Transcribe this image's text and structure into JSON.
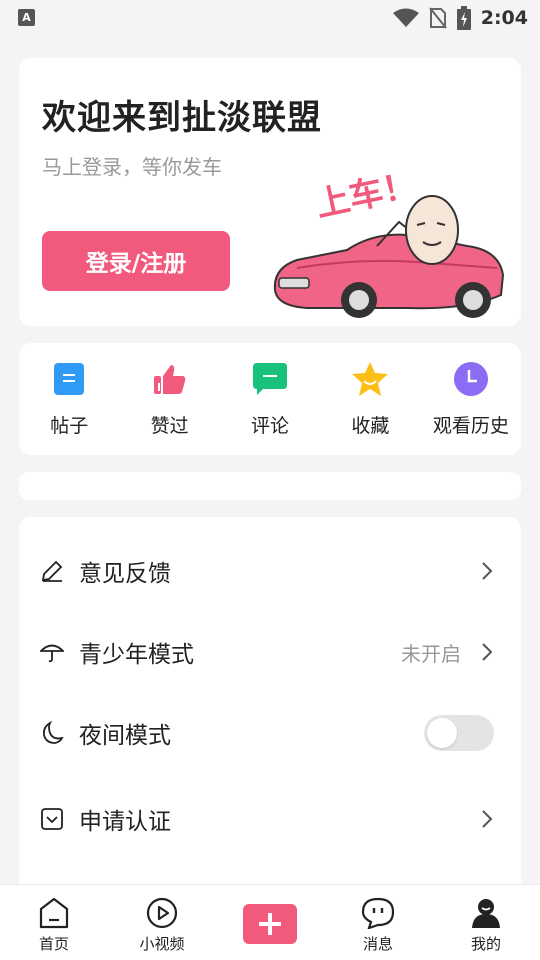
{
  "status_bar": {
    "left_badge": "A",
    "time": "2:04",
    "icons": [
      "wifi-icon",
      "no-sim-icon",
      "battery-charging-icon"
    ]
  },
  "hero": {
    "title": "欢迎来到扯淡联盟",
    "subtitle": "马上登录，等你发车",
    "login_button": "登录/注册",
    "art_text": "上车！"
  },
  "quick_actions": [
    {
      "label": "帖子",
      "icon": "post-icon",
      "color": "#2f9bf5"
    },
    {
      "label": "赞过",
      "icon": "thumb-up-icon",
      "color": "#f25a7d"
    },
    {
      "label": "评论",
      "icon": "comment-icon",
      "color": "#19c27a"
    },
    {
      "label": "收藏",
      "icon": "star-icon",
      "color": "#fbbf18"
    },
    {
      "label": "观看历史",
      "icon": "clock-icon",
      "color": "#8b6cf5"
    }
  ],
  "settings": [
    {
      "label": "意见反馈",
      "icon": "pencil-icon",
      "value": ""
    },
    {
      "label": "青少年模式",
      "icon": "umbrella-icon",
      "value": "未开启"
    },
    {
      "label": "夜间模式",
      "icon": "moon-icon",
      "toggle_on": false
    },
    {
      "label": "申请认证",
      "icon": "verify-icon",
      "value": ""
    }
  ],
  "bottom_nav": [
    {
      "label": "首页",
      "icon": "home-icon"
    },
    {
      "label": "小视频",
      "icon": "play-icon"
    },
    {
      "label": "",
      "icon": "add-icon"
    },
    {
      "label": "消息",
      "icon": "message-icon"
    },
    {
      "label": "我的",
      "icon": "profile-icon"
    }
  ],
  "colors": {
    "accent": "#f25a7d",
    "background": "#f4f4f6"
  }
}
